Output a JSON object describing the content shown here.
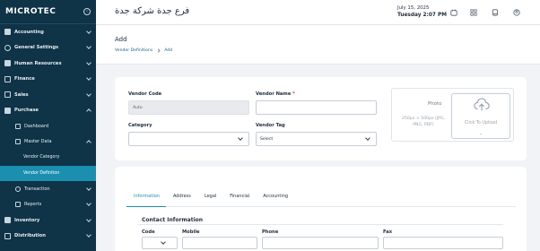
{
  "sidebar": {
    "logo": "MICROTEC",
    "items": [
      {
        "label": "Accounting",
        "icon": "accounting-icon"
      },
      {
        "label": "General Settings",
        "icon": "settings-icon"
      },
      {
        "label": "Human Resources",
        "icon": "people-icon"
      },
      {
        "label": "Finance",
        "icon": "finance-icon"
      },
      {
        "label": "Sales",
        "icon": "sales-icon"
      },
      {
        "label": "Purchase",
        "icon": "cart-icon"
      }
    ],
    "purchase_sub": {
      "dashboard": "Dashboard",
      "master_data": "Master Data",
      "vendor_category": "Vendor Category",
      "vendor_definition": "Vendor Definiton",
      "transaction": "Transaction",
      "reports": "Reports"
    },
    "bottom_items": [
      {
        "label": "Inventory",
        "icon": "inventory-icon"
      },
      {
        "label": "Distribution",
        "icon": "distribution-icon"
      }
    ]
  },
  "header": {
    "branch_name": "فرع جدة شركة جدة",
    "date": "July 15, 2025",
    "day_time": "Tuesday  2:07 PM"
  },
  "page": {
    "title": "Add",
    "breadcrumb": [
      "Vendor Definitions",
      "Add"
    ]
  },
  "form": {
    "vendor_code_label": "Vendor Code",
    "vendor_code_value": "Auto",
    "vendor_name_label": "Vendor Name",
    "vendor_name_required": "*",
    "category_label": "Category",
    "vendor_tag_label": "Vendor Tag",
    "vendor_tag_value": "Select",
    "photo_label": "Photo",
    "photo_hint": "250px × 500px (JPG, PNG, PDF)",
    "upload_label": "Click To Upload",
    "upload_dash": "-"
  },
  "tabs": [
    "Information",
    "Address",
    "Legal",
    "Financial",
    "Accounting"
  ],
  "contact": {
    "title": "Contact Information",
    "columns": [
      "Code",
      "Mobile",
      "Phone",
      "Fax"
    ]
  },
  "colors": {
    "sidebar_bg": "#0f3347",
    "accent": "#1b8fb0"
  }
}
